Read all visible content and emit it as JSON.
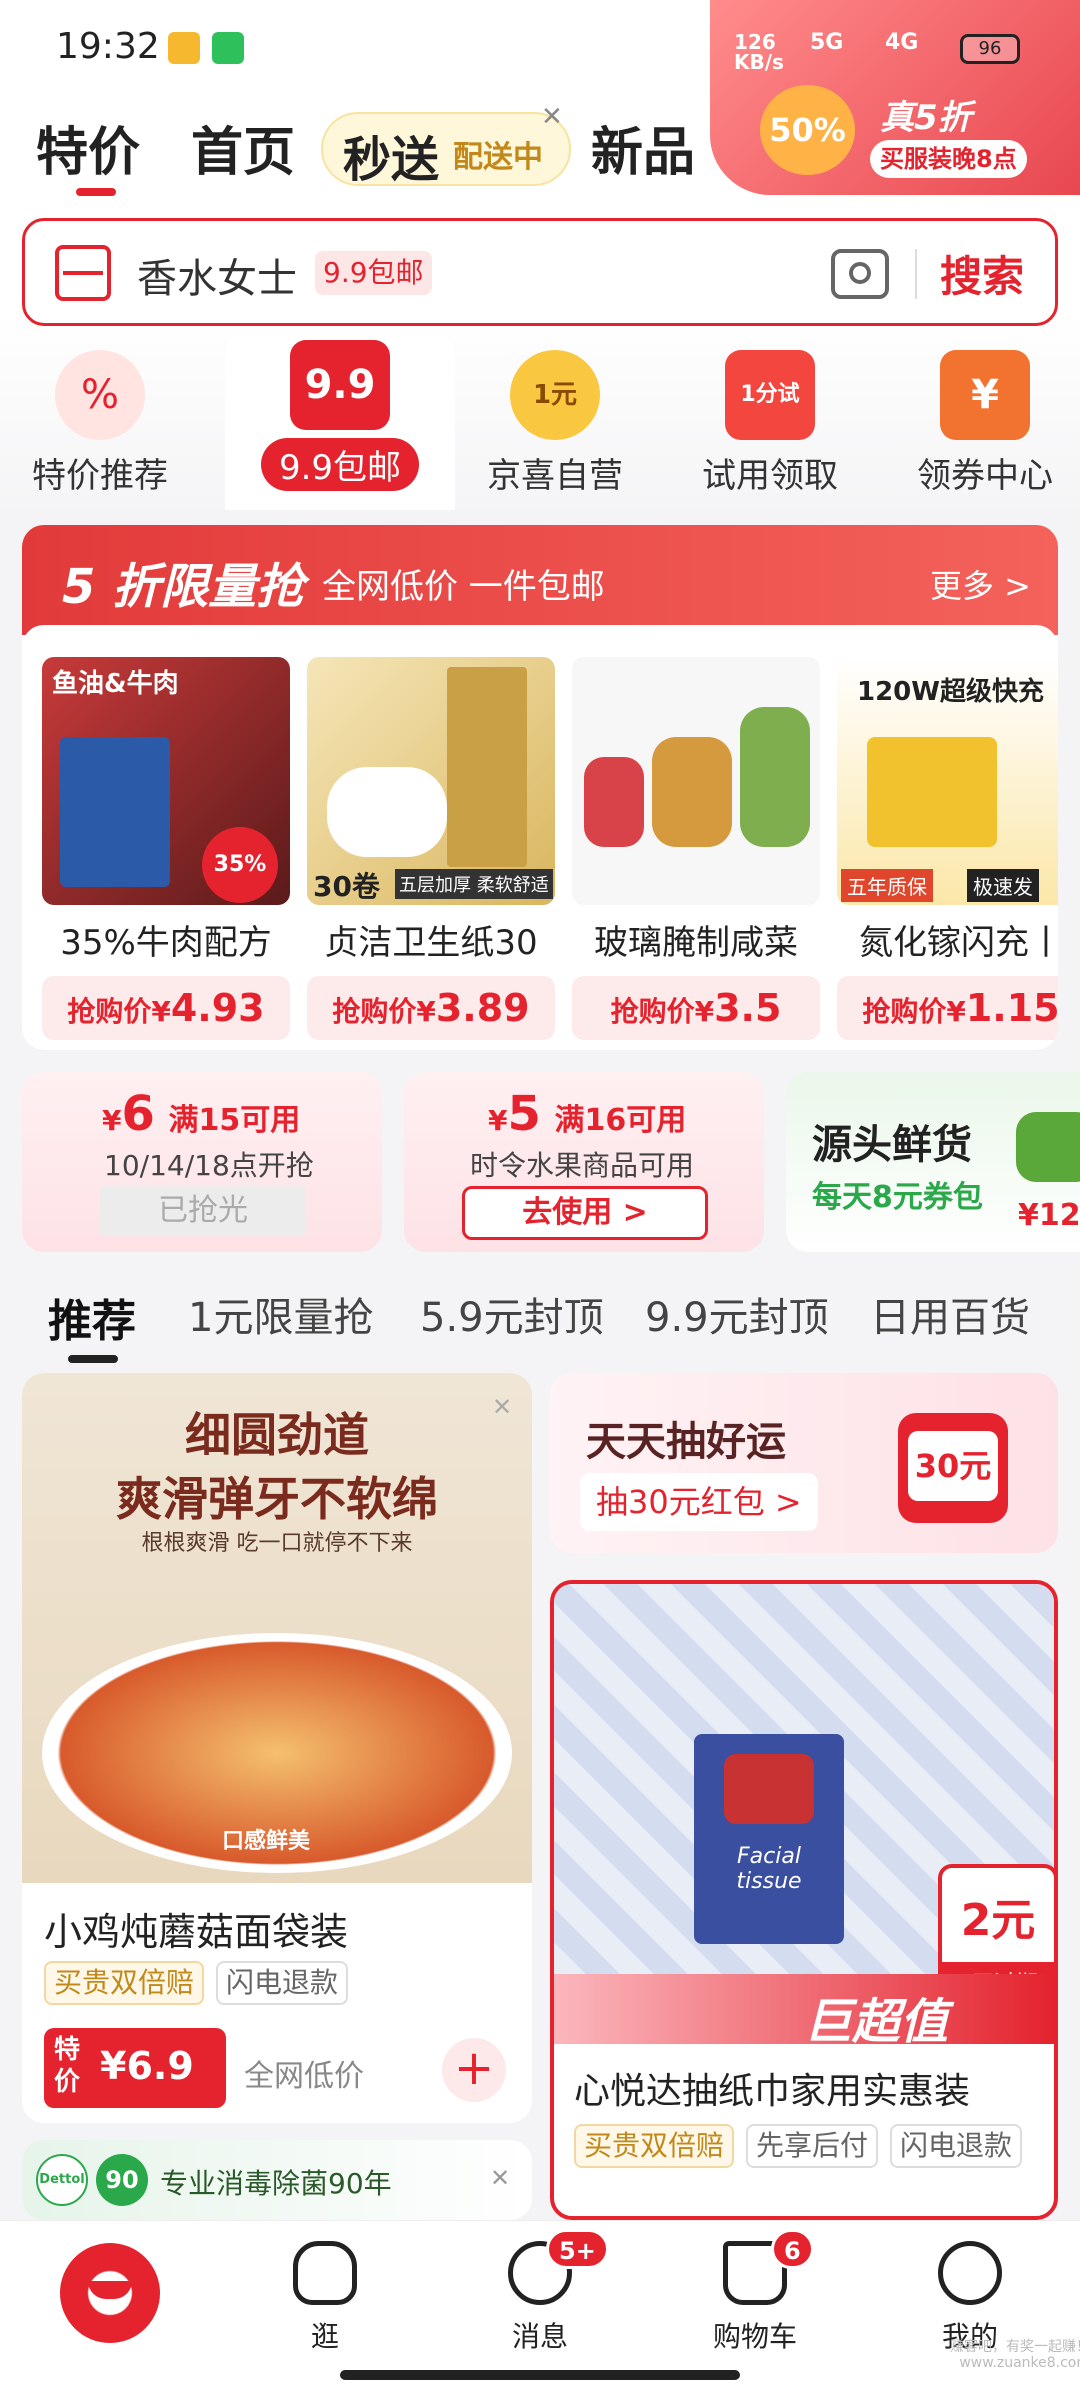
{
  "status": {
    "time": "19:32",
    "speed": "126\nKB/s",
    "net1": "5G",
    "net2": "4G",
    "battery": "96"
  },
  "top_tabs": {
    "deal": "特价",
    "home": "首页",
    "seckill": "秒送",
    "seckill_badge": "配送中",
    "new": "新品"
  },
  "promo_banner": {
    "title": "真5折",
    "pct": "50%",
    "sub": "买服装晚8点"
  },
  "search": {
    "placeholder": "香水女士",
    "tag": "9.9包邮",
    "button": "搜索"
  },
  "categories": [
    {
      "label": "特价推荐",
      "icon": "percent-icon"
    },
    {
      "label": "9.9包邮",
      "icon": "red-box-icon",
      "badge": "9.9"
    },
    {
      "label": "京喜自营",
      "icon": "one-yuan-icon",
      "badge": "1元"
    },
    {
      "label": "试用领取",
      "icon": "trial-bag-icon",
      "badge": "1分试"
    },
    {
      "label": "领券中心",
      "icon": "coupon-icon",
      "badge": "¥"
    }
  ],
  "flash_sale": {
    "title": "5 折限量抢",
    "subtitle": "全网低价 一件包邮",
    "more": "更多 >",
    "products": [
      {
        "name": "35%牛肉配方",
        "price_label": "抢购价¥",
        "price": "4.93",
        "img_top": "鱼油&牛肉",
        "img_badge": "35%",
        "img_sub": "牛肉"
      },
      {
        "name": "贞洁卫生纸30",
        "price_label": "抢购价¥",
        "price": "3.89",
        "img_top": "",
        "img_badge": "30卷",
        "img_sub": "五层加厚 柔软舒适"
      },
      {
        "name": "玻璃腌制咸菜",
        "price_label": "抢购价¥",
        "price": "3.5",
        "img_top": "",
        "img_badge": "",
        "img_sub": ""
      },
      {
        "name": "氮化镓闪充丨",
        "price_label": "抢购价¥",
        "price": "1.15",
        "img_top": "120W超级快充",
        "img_badge": "五年质保",
        "img_sub": "极速发"
      }
    ]
  },
  "coupons": [
    {
      "amount": "6",
      "cond": "满15可用",
      "desc": "10/14/18点开抢",
      "button": "已抢光"
    },
    {
      "amount": "5",
      "cond": "满16可用",
      "desc": "时令水果商品可用",
      "button": "去使用 >"
    },
    {
      "title": "源头鲜货",
      "desc": "每天8元券包",
      "price": "¥12."
    }
  ],
  "feed_tabs": [
    "推荐",
    "1元限量抢",
    "5.9元封顶",
    "9.9元封顶",
    "日用百货"
  ],
  "feed": {
    "noodle": {
      "headline1": "细圆劲道",
      "headline2": "爽滑弹牙不软绵",
      "tagline": "根根爽滑 吃一口就停不下来",
      "stamp": "口感鲜美",
      "name": "小鸡炖蘑菇面袋装",
      "tags": [
        "买贵双倍赔",
        "闪电退款"
      ],
      "price_tag": "特价",
      "price": "¥6.9",
      "note": "全网低价"
    },
    "lucky": {
      "title": "天天抽好运",
      "button": "抽30元红包 >",
      "amount": "30元"
    },
    "tissue": {
      "name": "心悦达抽纸巾家用实惠装",
      "tags": [
        "买贵双倍赔",
        "先享后付",
        "闪电退款"
      ],
      "coupon_amount": "2元",
      "coupon_exp": "1天过期",
      "big_text": "巨超值",
      "brand": "Facial tissue"
    },
    "dettol": {
      "brand": "Dettol",
      "years": "90",
      "text": "专业消毒除菌90年"
    }
  },
  "bottom_nav": [
    {
      "label": "",
      "icon": "mascot-icon"
    },
    {
      "label": "逛",
      "icon": "browse-icon"
    },
    {
      "label": "消息",
      "icon": "message-icon",
      "badge": "5+"
    },
    {
      "label": "购物车",
      "icon": "cart-icon",
      "badge": "6"
    },
    {
      "label": "我的",
      "icon": "profile-icon"
    }
  ],
  "watermark": "赚客吧，有奖一起赚！\nwww.zuanke8.com",
  "colors": {
    "accent": "#e4232e",
    "gold": "#f5b82e",
    "green": "#2aa84a"
  }
}
